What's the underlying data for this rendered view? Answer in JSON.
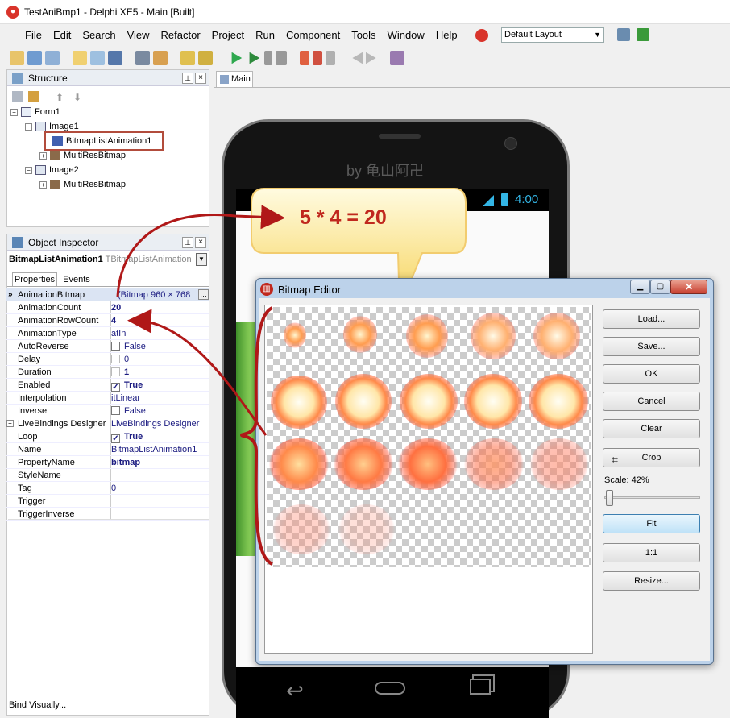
{
  "window": {
    "title": "TestAniBmp1 - Delphi XE5 - Main [Built]"
  },
  "menu": [
    "File",
    "Edit",
    "Search",
    "View",
    "Refactor",
    "Project",
    "Run",
    "Component",
    "Tools",
    "Window",
    "Help"
  ],
  "layout": {
    "value": "Default Layout"
  },
  "structure": {
    "title": "Structure",
    "nodes": [
      "Form1",
      "Image1",
      "BitmapListAnimation1",
      "MultiResBitmap",
      "Image2",
      "MultiResBitmap"
    ]
  },
  "designer": {
    "tab": "Main",
    "watermark": "by 龟山阿卍",
    "clock": "4:00"
  },
  "callout": {
    "text": "5 * 4 = 20"
  },
  "inspector": {
    "title": "Object Inspector",
    "object": "BitmapListAnimation1",
    "object_type": "TBitmapListAnimation",
    "tabs": [
      "Properties",
      "Events"
    ],
    "rows": [
      {
        "name": "AnimationBitmap",
        "value": "(Bitmap 960 × 768"
      },
      {
        "name": "AnimationCount",
        "value": "20"
      },
      {
        "name": "AnimationRowCount",
        "value": "4"
      },
      {
        "name": "AnimationType",
        "value": "atIn"
      },
      {
        "name": "AutoReverse",
        "value": "False"
      },
      {
        "name": "Delay",
        "value": "0"
      },
      {
        "name": "Duration",
        "value": "1"
      },
      {
        "name": "Enabled",
        "value": "True"
      },
      {
        "name": "Interpolation",
        "value": "itLinear"
      },
      {
        "name": "Inverse",
        "value": "False"
      },
      {
        "name": "LiveBindings Designer",
        "value": "LiveBindings Designer"
      },
      {
        "name": "Loop",
        "value": "True"
      },
      {
        "name": "Name",
        "value": "BitmapListAnimation1"
      },
      {
        "name": "PropertyName",
        "value": "bitmap"
      },
      {
        "name": "StyleName",
        "value": ""
      },
      {
        "name": "Tag",
        "value": "0"
      },
      {
        "name": "Trigger",
        "value": ""
      },
      {
        "name": "TriggerInverse",
        "value": ""
      }
    ],
    "footer": "Bind Visually..."
  },
  "editor": {
    "title": "Bitmap Editor",
    "buttons": {
      "load": "Load...",
      "save": "Save...",
      "ok": "OK",
      "cancel": "Cancel",
      "clear": "Clear",
      "crop": "Crop",
      "fit": "Fit",
      "one": "1:1",
      "resize": "Resize..."
    },
    "scale_label": "Scale: 42%",
    "scale": 0.42
  },
  "colors": {
    "accent": "#c0281e",
    "arrow": "#b01818",
    "callout": "#fff1b0"
  }
}
